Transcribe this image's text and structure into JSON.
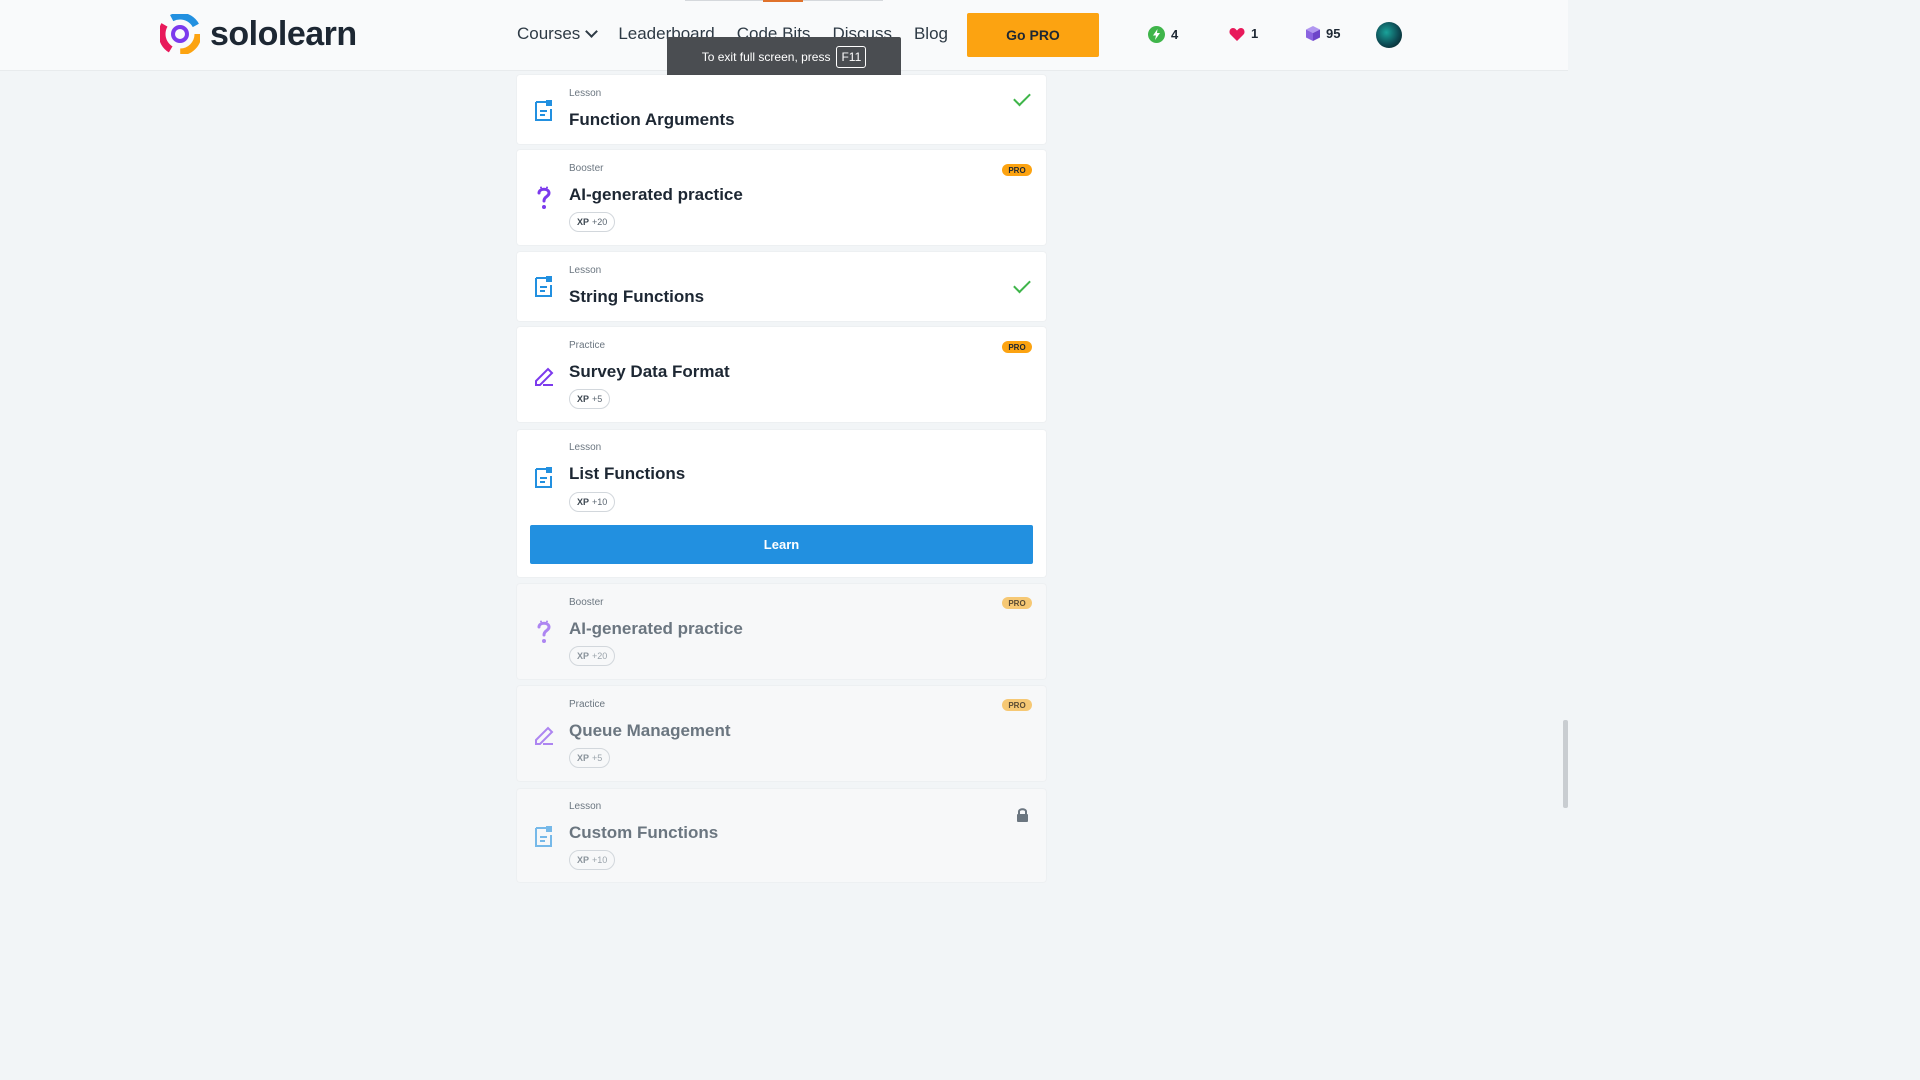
{
  "header": {
    "logo_text": "sololearn",
    "nav": [
      "Courses",
      "Leaderboard",
      "Code Bits",
      "Discuss",
      "Blog"
    ],
    "go_pro": "Go PRO",
    "streak": "4",
    "hearts": "1",
    "bits": "95"
  },
  "tooltip": {
    "text": "To exit full screen, press",
    "key": "F11"
  },
  "items": [
    {
      "kind": "Lesson",
      "title": "Function Arguments",
      "status": "completed"
    },
    {
      "kind": "Booster",
      "title": "AI-generated practice",
      "badge": "PRO",
      "xp_label": "XP",
      "xp_value": "+20"
    },
    {
      "kind": "Lesson",
      "title": "String Functions",
      "status": "completed"
    },
    {
      "kind": "Practice",
      "title": "Survey Data Format",
      "badge": "PRO",
      "xp_label": "XP",
      "xp_value": "+5"
    },
    {
      "kind": "Lesson",
      "title": "List Functions",
      "xp_label": "XP",
      "xp_value": "+10",
      "action": "Learn"
    },
    {
      "kind": "Booster",
      "title": "AI-generated practice",
      "badge": "PRO",
      "xp_label": "XP",
      "xp_value": "+20"
    },
    {
      "kind": "Practice",
      "title": "Queue Management",
      "badge": "PRO",
      "xp_label": "XP",
      "xp_value": "+5"
    },
    {
      "kind": "Lesson",
      "title": "Custom Functions",
      "status": "locked",
      "xp_label": "XP",
      "xp_value": "+10"
    }
  ],
  "colors": {
    "accent": "#2290e0",
    "pro": "#fca311",
    "check": "#3fb54a"
  }
}
